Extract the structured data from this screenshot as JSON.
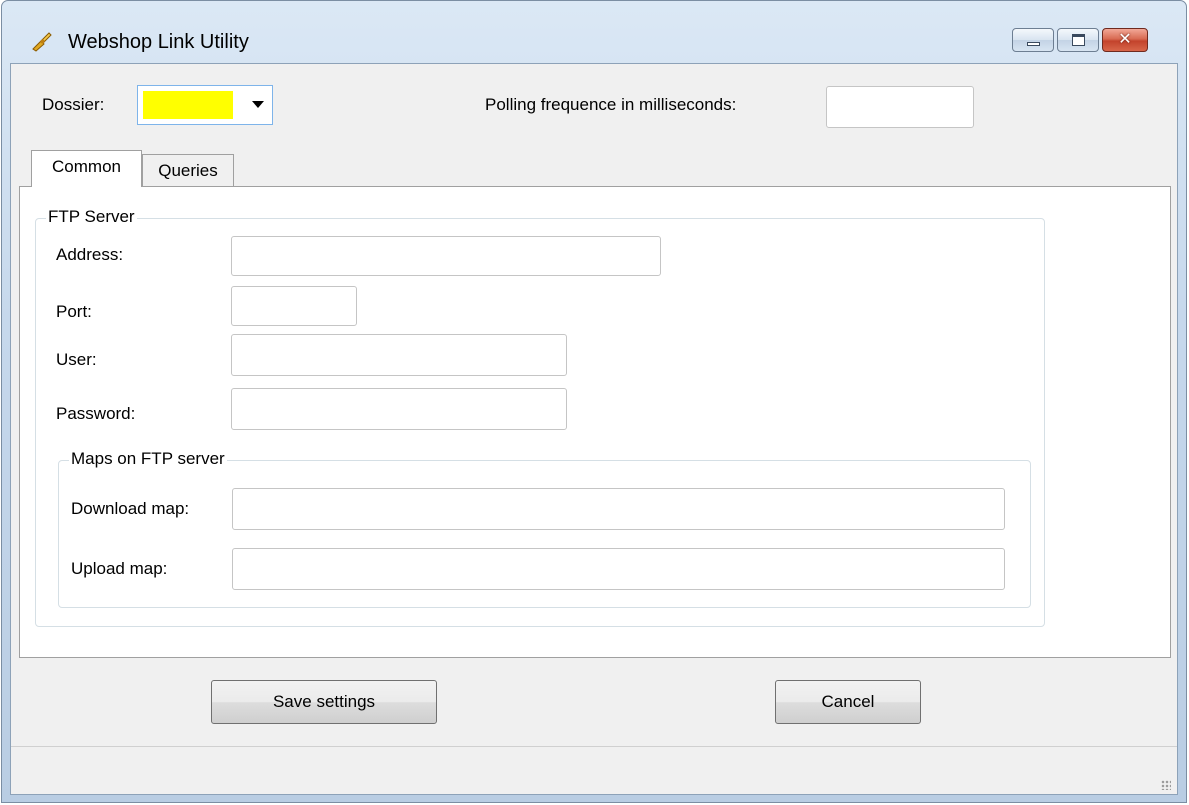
{
  "window": {
    "title": "Webshop Link Utility",
    "icons": {
      "app": "webshop-link-icon",
      "minimize": "minimize-icon",
      "maximize": "maximize-icon",
      "close": "close-icon"
    }
  },
  "header": {
    "dossier_label": "Dossier:",
    "dossier_value": "",
    "dossier_color": "#ffff00",
    "polling_label": "Polling frequence in milliseconds:",
    "polling_value": ""
  },
  "tabs": [
    {
      "label": "Common",
      "active": true
    },
    {
      "label": "Queries",
      "active": false
    }
  ],
  "ftp": {
    "group_label": "FTP Server",
    "address_label": "Address:",
    "address_value": "",
    "port_label": "Port:",
    "port_value": "",
    "user_label": "User:",
    "user_value": "",
    "password_label": "Password:",
    "password_value": "",
    "maps": {
      "group_label": "Maps on FTP server",
      "download_label": "Download map:",
      "download_value": "",
      "upload_label": "Upload map:",
      "upload_value": ""
    }
  },
  "buttons": {
    "save": "Save settings",
    "cancel": "Cancel"
  }
}
